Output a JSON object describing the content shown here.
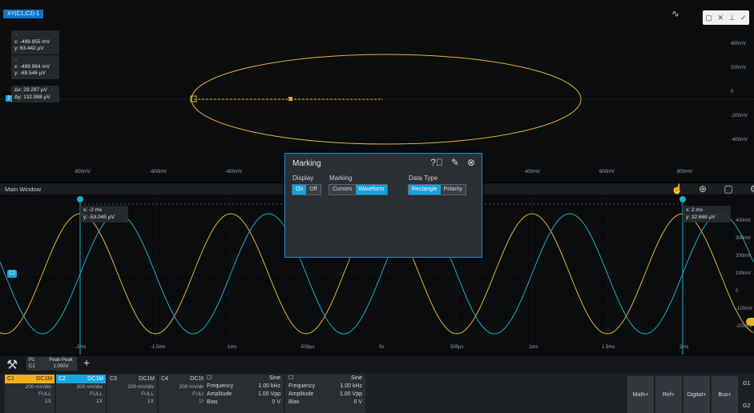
{
  "xy_window": {
    "tab_label": "XY(C1,C2)-1",
    "cursor1": {
      "x": "x: -499.955 mV",
      "y": "y: 63.442 µV"
    },
    "cursor2": {
      "x": "x: -499.984 mV",
      "y": "y: -69.546 µV"
    },
    "delta": {
      "dx": "Δx: 29.297 µV",
      "dy": "Δy: 132.988 µV"
    },
    "y_ticks": [
      "400mV",
      "300mV",
      "200mV",
      "100mV",
      "0",
      "-100mV",
      "-200mV",
      "-300mV",
      "-400mV"
    ],
    "x_ticks": [
      "-800mV",
      "-600mV",
      "-400mV",
      "-200mV",
      "0",
      "200mV",
      "400mV",
      "600mV",
      "800mV"
    ]
  },
  "main_window": {
    "title": "Main Window",
    "cursor_a": {
      "x": "x: -2 ms",
      "y": "y: -53.045 µV"
    },
    "cursor_b": {
      "x": "x: 2 ms",
      "y": "y: 32.668 µV"
    },
    "y_ticks": [
      "400mV",
      "300mV",
      "200mV",
      "100mV",
      "0",
      "-100mV",
      "-200mV",
      "-300mV",
      "-400mV"
    ],
    "x_ticks": [
      "-2ms",
      "-1.5ms",
      "-1ms",
      "-500µs",
      "0s",
      "500µs",
      "1ms",
      "1.5ms",
      "2ms"
    ],
    "ch1_marker": "C1",
    "ch2_marker": "C2"
  },
  "dialog": {
    "title": "Marking",
    "display_label": "Display",
    "display_on": "On",
    "display_off": "Off",
    "marking_label": "Marking",
    "marking_options": [
      "Cursors",
      "Waveform"
    ],
    "datatype_label": "Data Type",
    "datatype_options": [
      "Rectangle",
      "Polarity"
    ]
  },
  "toolbar": {
    "meas_tag": "P1",
    "meas_sub": "C1",
    "meas_name": "Peak-Peak",
    "meas_value": "1.000V",
    "add": "+"
  },
  "channels": [
    {
      "name": "C1",
      "coupling": "DC1M",
      "scale": "200 mV/div",
      "bw": "FULL",
      "probe": "1X",
      "color": "#f0b019"
    },
    {
      "name": "C2",
      "coupling": "DC1M",
      "scale": "200 mV/div",
      "bw": "FULL",
      "probe": "1X",
      "color": "#16a6e0"
    },
    {
      "name": "C3",
      "coupling": "DC1M",
      "scale": "200 mV/div",
      "bw": "FULL",
      "probe": "1X",
      "color": "#2a2e33"
    },
    {
      "name": "C4",
      "coupling": "DC1M",
      "scale": "200 mV/div",
      "bw": "FULL",
      "probe": "1X",
      "color": "#2a2e33"
    }
  ],
  "measurements": [
    {
      "head": "Sine",
      "rows": [
        [
          "Frequency",
          "1.00 kHz"
        ],
        [
          "Amplitude",
          "1.00 Vpp"
        ],
        [
          "Bias",
          "0 V"
        ]
      ]
    },
    {
      "head": "Sine",
      "rows": [
        [
          "Frequency",
          "1.00 kHz"
        ],
        [
          "Amplitude",
          "1.00 Vpp"
        ],
        [
          "Bias",
          "0 V"
        ]
      ]
    }
  ],
  "right_buttons": [
    "Math+",
    "Ref+",
    "Digital+",
    "Bus+"
  ],
  "edge_labels": [
    "G1",
    "G2"
  ],
  "colors": {
    "ch1": "#e3b52a",
    "ch2": "#17b0c9",
    "accent": "#12a2dd"
  }
}
